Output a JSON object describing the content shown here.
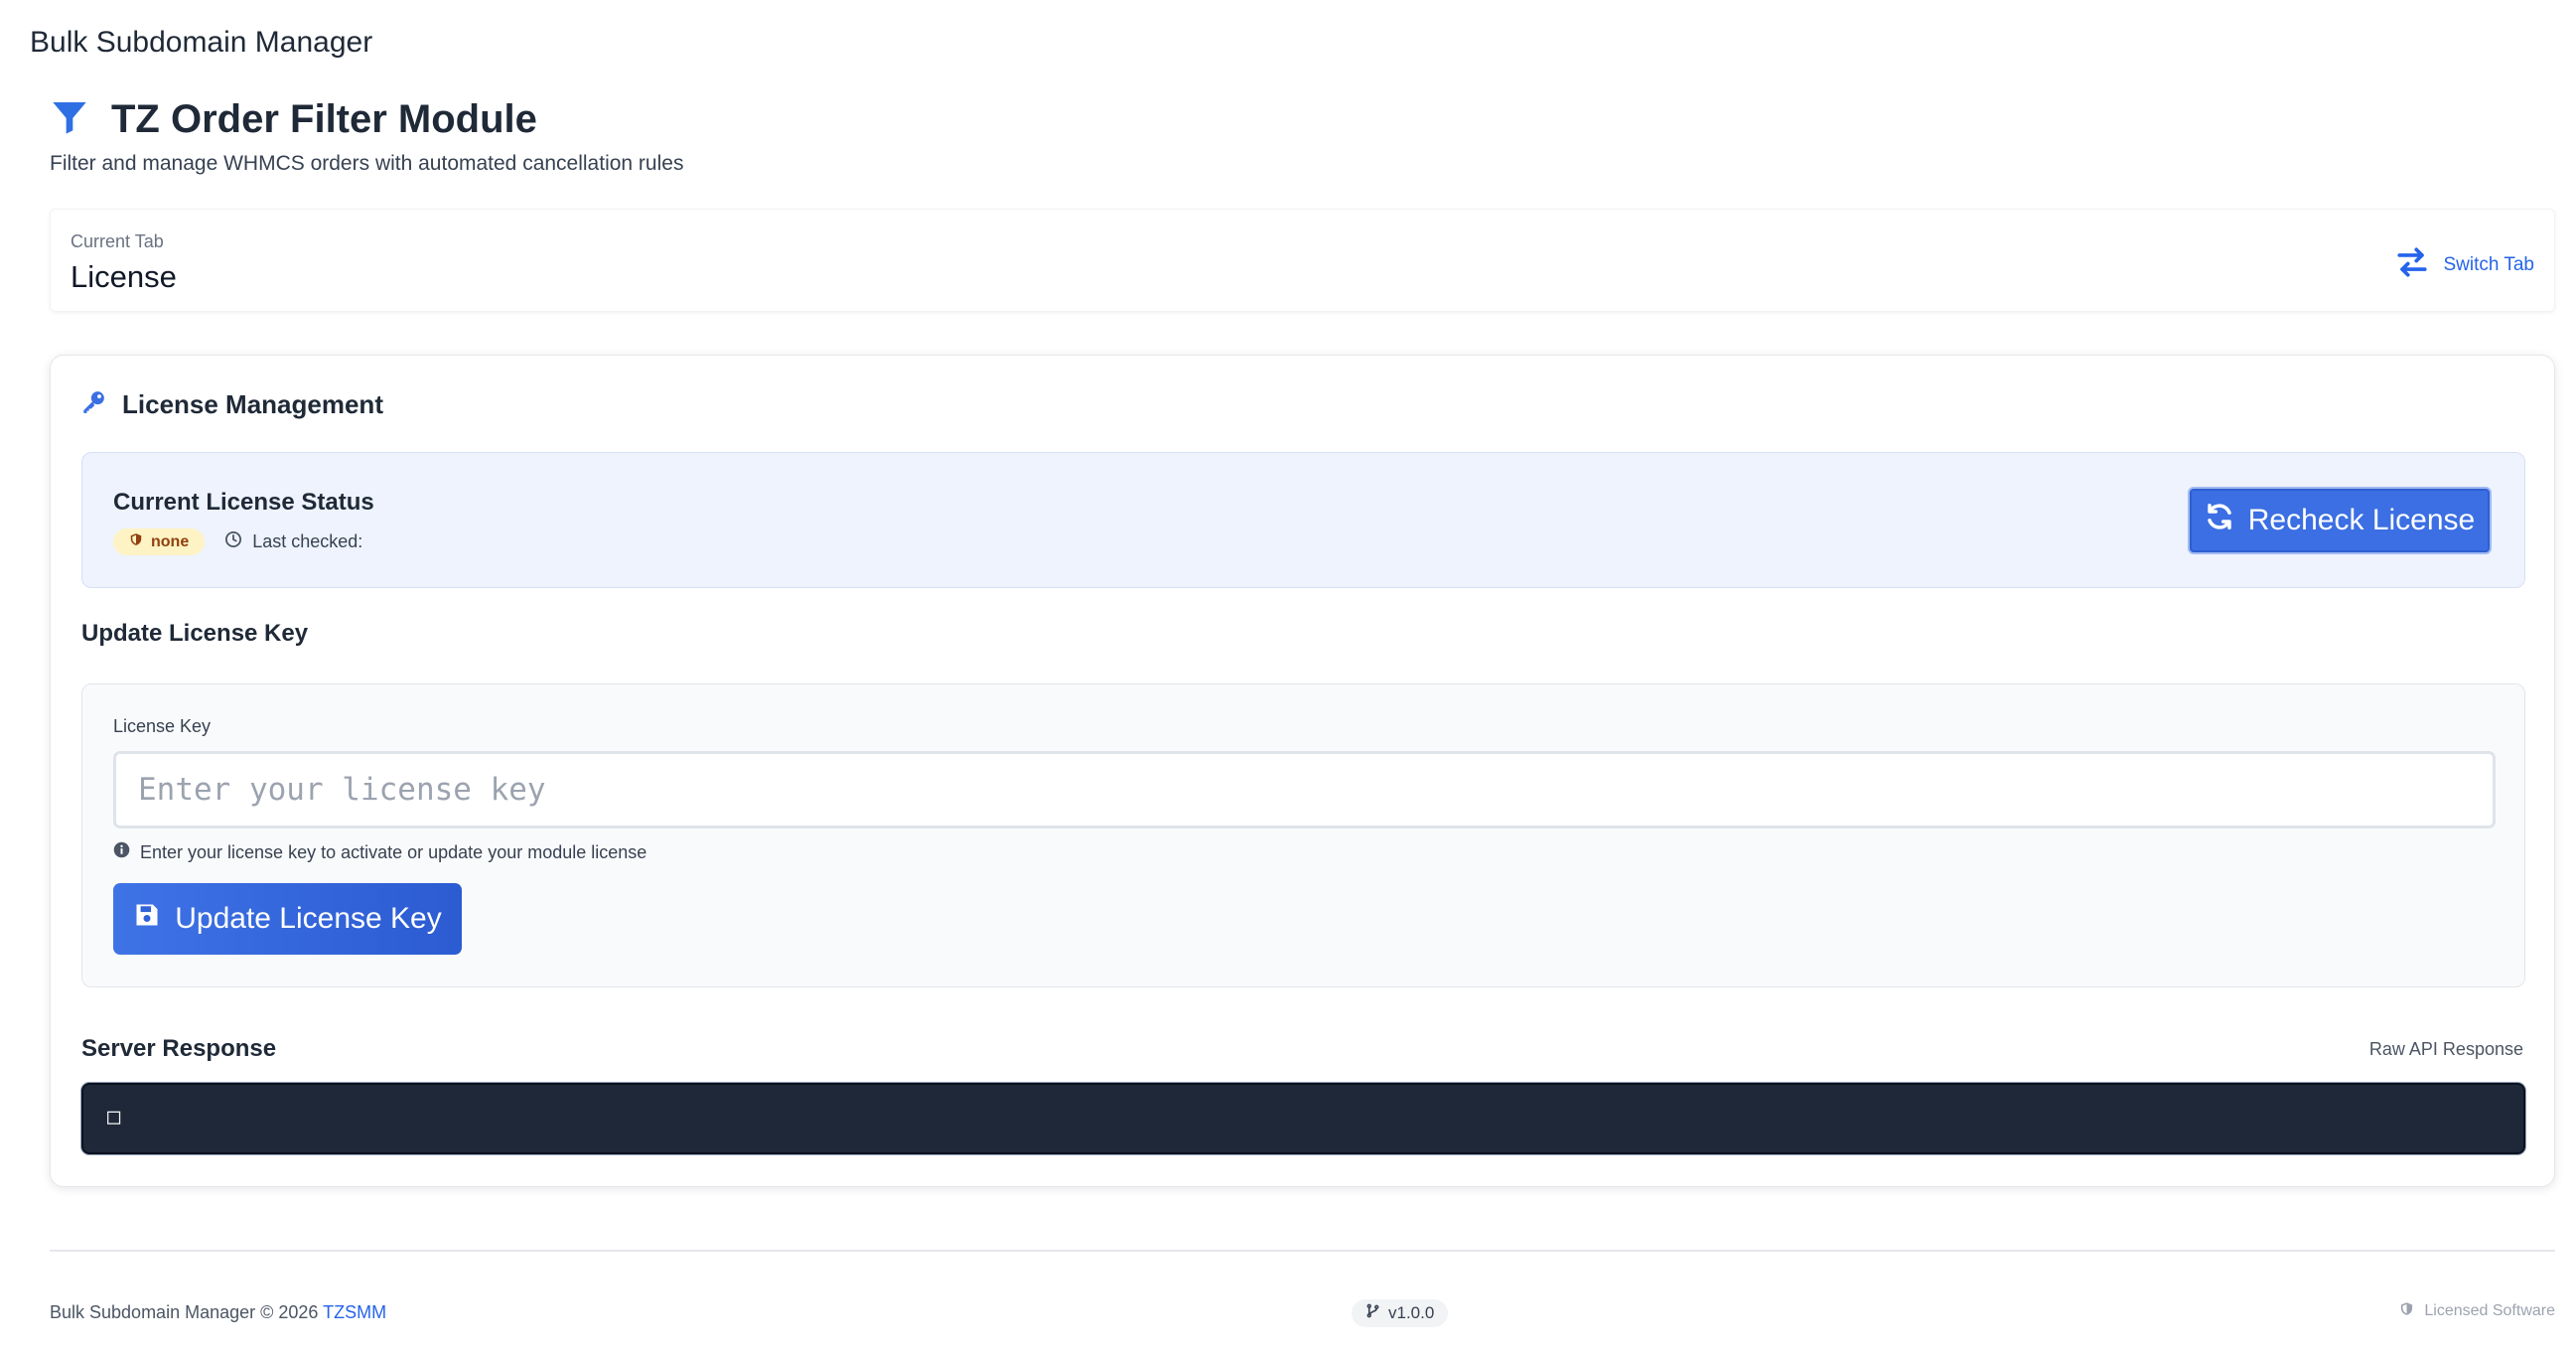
{
  "app": {
    "title": "Bulk Subdomain Manager"
  },
  "module": {
    "title": "TZ Order Filter Module",
    "subtitle": "Filter and manage WHMCS orders with automated cancellation rules",
    "icon": "filter-icon"
  },
  "tab_bar": {
    "label": "Current Tab",
    "value": "License",
    "switch_label": "Switch Tab",
    "switch_icon": "arrows-exchange-icon"
  },
  "license_card": {
    "title": "License Management",
    "icon": "key-icon",
    "status": {
      "title": "Current License Status",
      "badge": "none",
      "last_checked_label": "Last checked:",
      "recheck_label": "Recheck License"
    },
    "update": {
      "section_title": "Update License Key",
      "field_label": "License Key",
      "input_value": "",
      "input_placeholder": "Enter your license key",
      "help_text": "Enter your license key to activate or update your module license",
      "button_label": "Update License Key"
    },
    "response": {
      "section_title": "Server Response",
      "raw_label": "Raw API Response",
      "content": "□"
    }
  },
  "footer": {
    "copyright": "Bulk Subdomain Manager © 2026",
    "link_text": "TZSMM",
    "version": "v1.0.0",
    "license_text": "Licensed Software"
  },
  "colors": {
    "accent": "#2563eb",
    "button_primary": "#3b6fe3",
    "status_panel_bg": "#eef3fd",
    "badge_bg": "#fdf3c4",
    "response_bg": "#1f2838"
  }
}
